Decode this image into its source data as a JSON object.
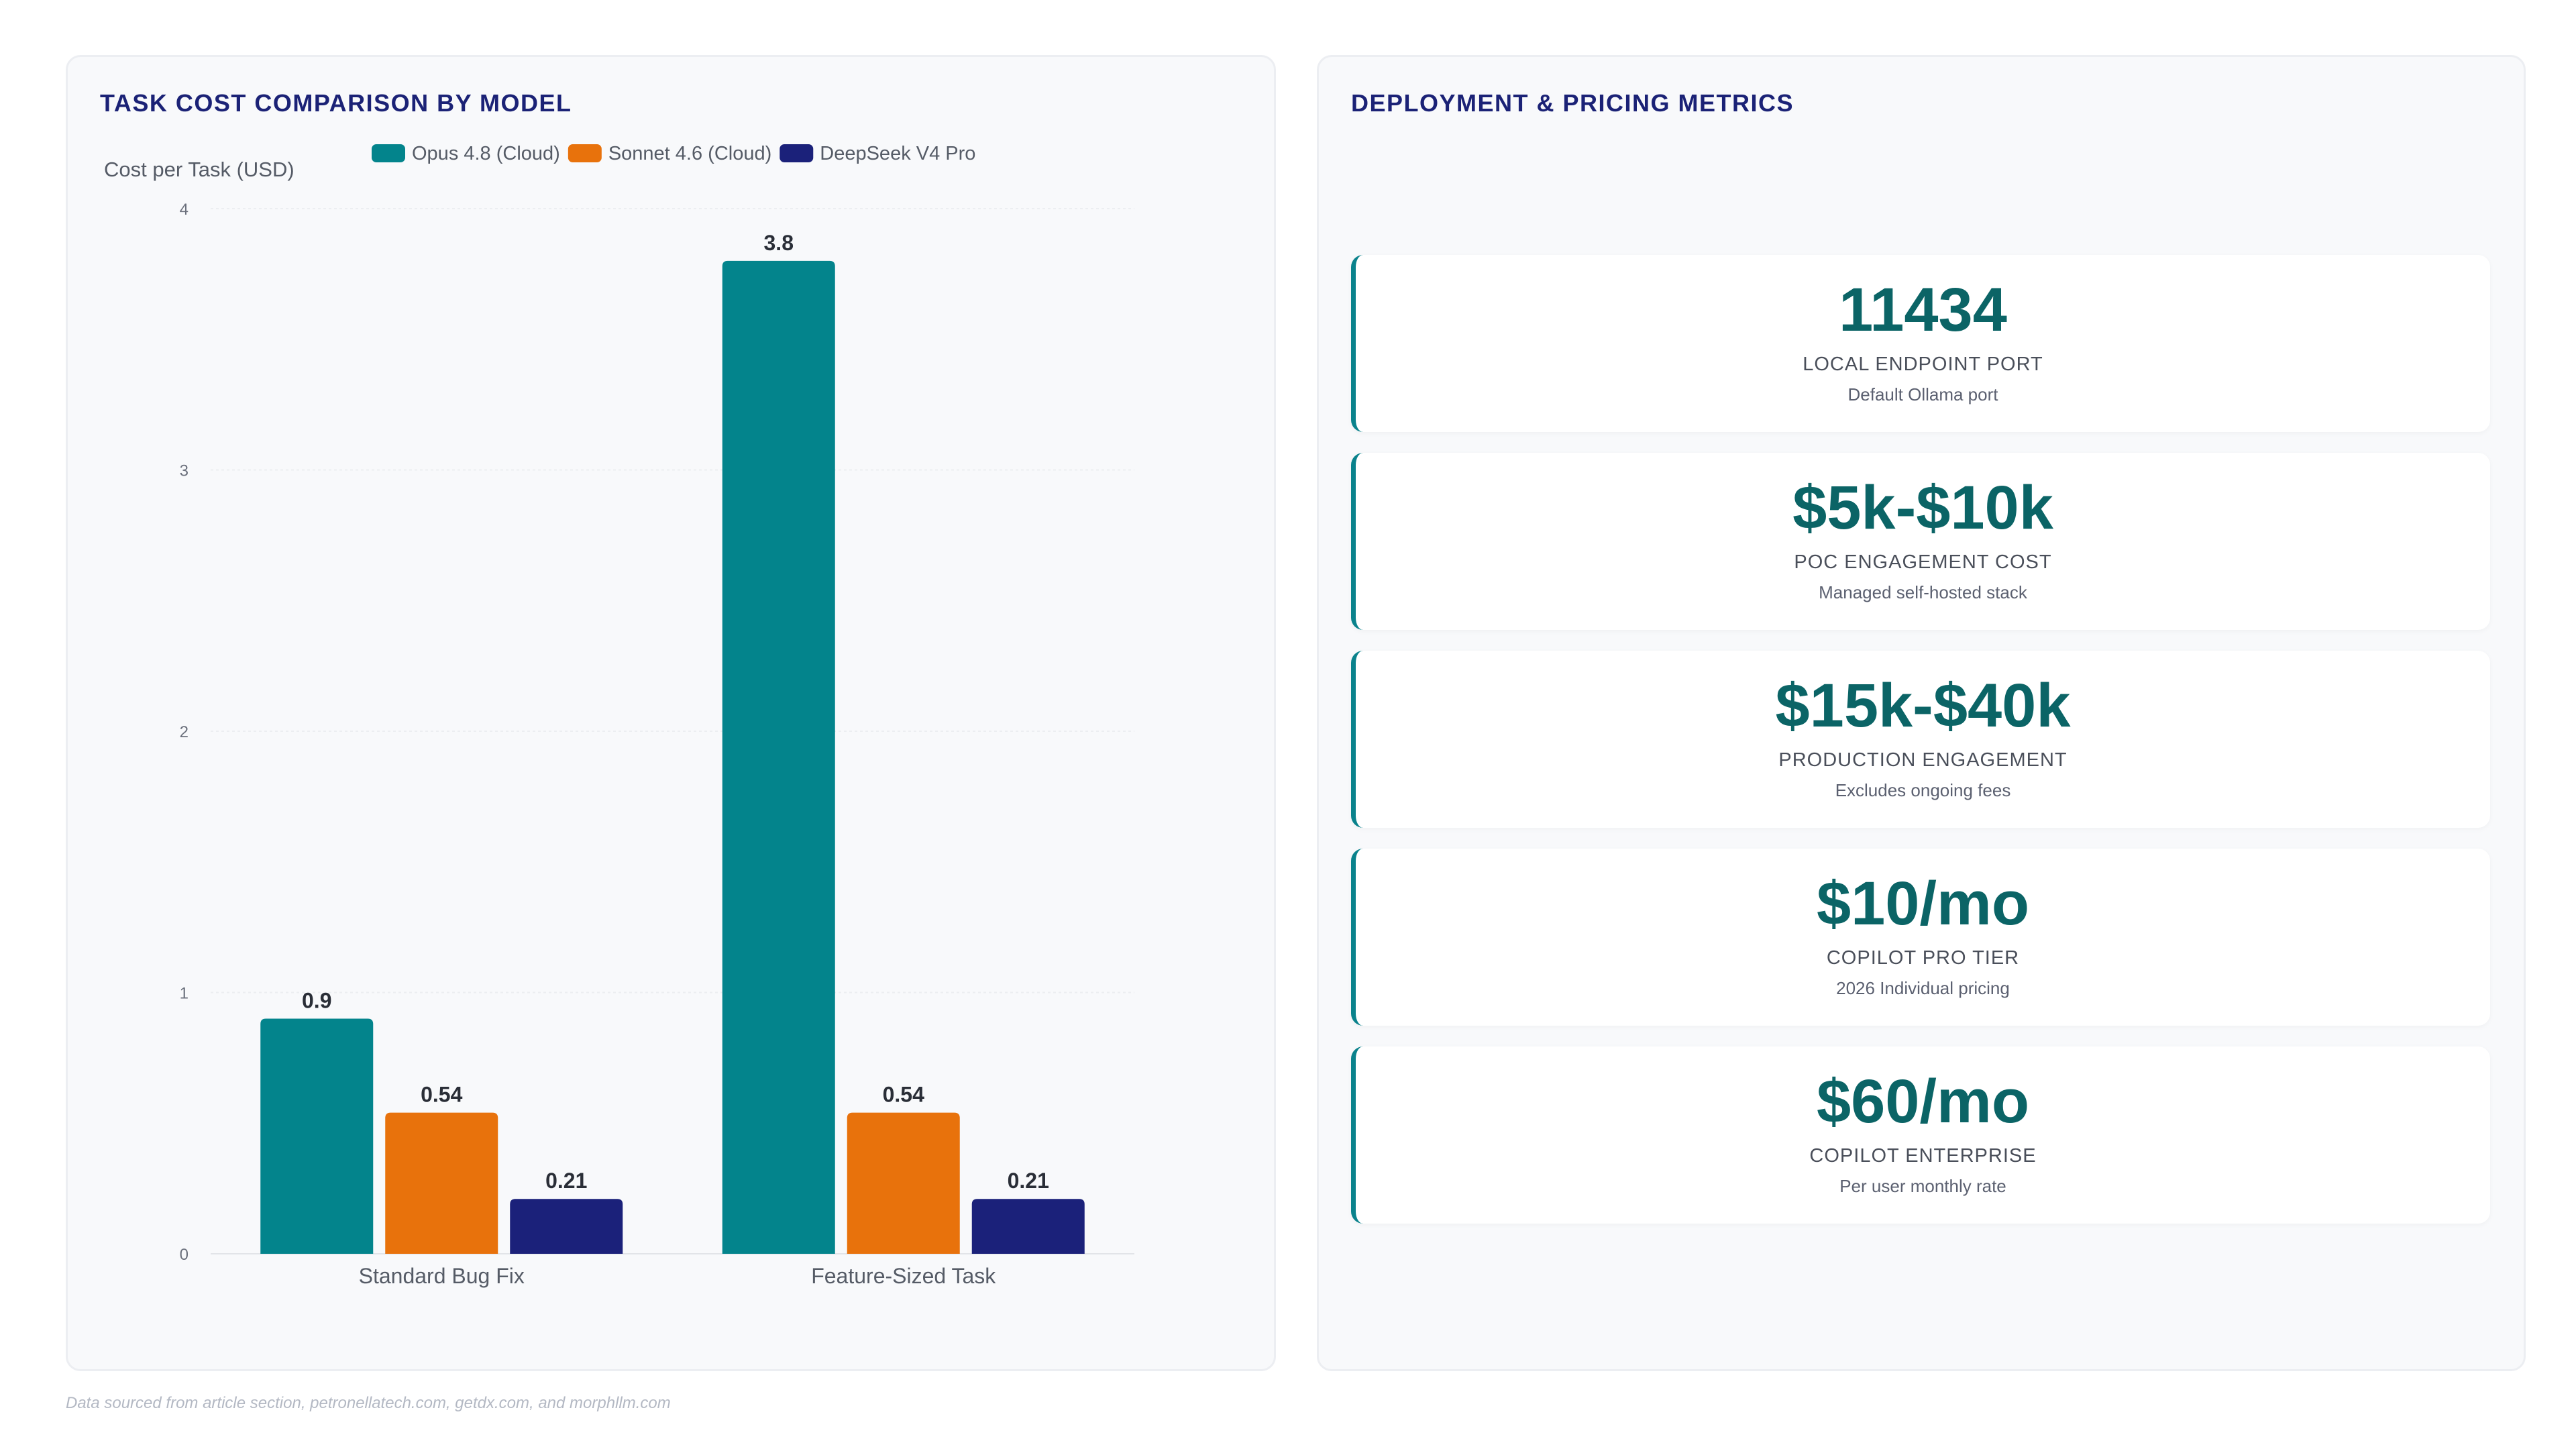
{
  "chart_panel": {
    "title": "TASK COST COMPARISON BY MODEL"
  },
  "chart_data": {
    "type": "bar",
    "title": "TASK COST COMPARISON BY MODEL",
    "xlabel": "",
    "ylabel": "Cost per Task (USD)",
    "ylim": [
      0,
      4
    ],
    "yticks": [
      0,
      1,
      2,
      3,
      4
    ],
    "categories": [
      "Standard Bug Fix",
      "Feature-Sized Task"
    ],
    "series": [
      {
        "name": "Opus 4.8 (Cloud)",
        "color": "#03848c",
        "values": [
          0.9,
          3.8
        ]
      },
      {
        "name": "Sonnet 4.6 (Cloud)",
        "color": "#e8720c",
        "values": [
          0.54,
          0.54
        ]
      },
      {
        "name": "DeepSeek V4 Pro",
        "color": "#1b217a",
        "values": [
          0.21,
          0.21
        ]
      }
    ],
    "legend_position": "top",
    "grid": true,
    "data_labels": true
  },
  "metrics_panel": {
    "title": "DEPLOYMENT & PRICING METRICS",
    "cards": [
      {
        "value": "11434",
        "label": "LOCAL ENDPOINT PORT",
        "sub": "Default Ollama port"
      },
      {
        "value": "$5k-$10k",
        "label": "POC ENGAGEMENT COST",
        "sub": "Managed self-hosted stack"
      },
      {
        "value": "$15k-$40k",
        "label": "PRODUCTION ENGAGEMENT",
        "sub": "Excludes ongoing fees"
      },
      {
        "value": "$10/mo",
        "label": "COPILOT PRO TIER",
        "sub": "2026 Individual pricing"
      },
      {
        "value": "$60/mo",
        "label": "COPILOT ENTERPRISE",
        "sub": "Per user monthly rate"
      }
    ],
    "accent_color": "#0a828c",
    "value_color": "#0b6466"
  },
  "footnote": "Data sourced from article section, petronellatech.com, getdx.com, and morphllm.com"
}
